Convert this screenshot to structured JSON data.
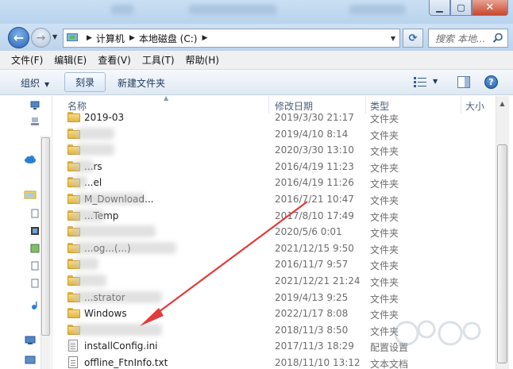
{
  "window": {
    "controls": {
      "minimize": "▁",
      "maximize": "▢",
      "close": "✕"
    }
  },
  "address": {
    "crumbs": [
      "计算机",
      "本地磁盘 (C:)"
    ],
    "search_placeholder": "搜索 本地..."
  },
  "menu": [
    "文件(F)",
    "编辑(E)",
    "查看(V)",
    "工具(T)",
    "帮助(H)"
  ],
  "toolbar": {
    "organize": "组织",
    "burn": "刻录",
    "new_folder": "新建文件夹"
  },
  "columns": {
    "name": "名称",
    "date": "修改日期",
    "type": "类型",
    "size": "大小"
  },
  "files": [
    {
      "name": "2019-03",
      "date": "2019/3/30 21:17",
      "type": "文件夹",
      "icon": "folder"
    },
    {
      "name": "",
      "date": "2019/4/10 8:14",
      "type": "文件夹",
      "icon": "folder"
    },
    {
      "name": "",
      "date": "2020/3/30 13:10",
      "type": "文件夹",
      "icon": "folder"
    },
    {
      "name": "...rs",
      "date": "2016/4/19 11:23",
      "type": "文件夹",
      "icon": "folder"
    },
    {
      "name": "...el",
      "date": "2016/4/19 11:26",
      "type": "文件夹",
      "icon": "folder"
    },
    {
      "name": "M_Download...",
      "date": "2016/7/21 10:47",
      "type": "文件夹",
      "icon": "folder"
    },
    {
      "name": "...Temp",
      "date": "2017/8/10 17:49",
      "type": "文件夹",
      "icon": "folder"
    },
    {
      "name": "",
      "date": "2020/5/6 0:01",
      "type": "文件夹",
      "icon": "folder"
    },
    {
      "name": "...og...(...)",
      "date": "2021/12/15 9:50",
      "type": "文件夹",
      "icon": "folder"
    },
    {
      "name": "",
      "date": "2016/11/7 9:57",
      "type": "文件夹",
      "icon": "folder"
    },
    {
      "name": "",
      "date": "2021/12/21 21:24",
      "type": "文件夹",
      "icon": "folder"
    },
    {
      "name": "...strator",
      "date": "2019/4/13 9:25",
      "type": "文件夹",
      "icon": "folder"
    },
    {
      "name": "Windows",
      "date": "2022/1/17 8:08",
      "type": "文件夹",
      "icon": "folder"
    },
    {
      "name": "",
      "date": "2018/11/3 8:50",
      "type": "文件夹",
      "icon": "folder"
    },
    {
      "name": "installConfig.ini",
      "date": "2017/11/3 18:29",
      "type": "配置设置",
      "icon": "file"
    },
    {
      "name": "offline_FtnInfo.txt",
      "date": "2018/11/10 13:12",
      "type": "文本文档",
      "icon": "file"
    }
  ],
  "colors": {
    "accent": "#2a63b4",
    "arrow": "#e23b3b",
    "folder": "#f0c75a"
  },
  "icons": {
    "back": "arrow-left-icon",
    "forward": "arrow-right-icon",
    "refresh": "refresh-icon",
    "search": "search-icon",
    "help": "help-icon"
  }
}
